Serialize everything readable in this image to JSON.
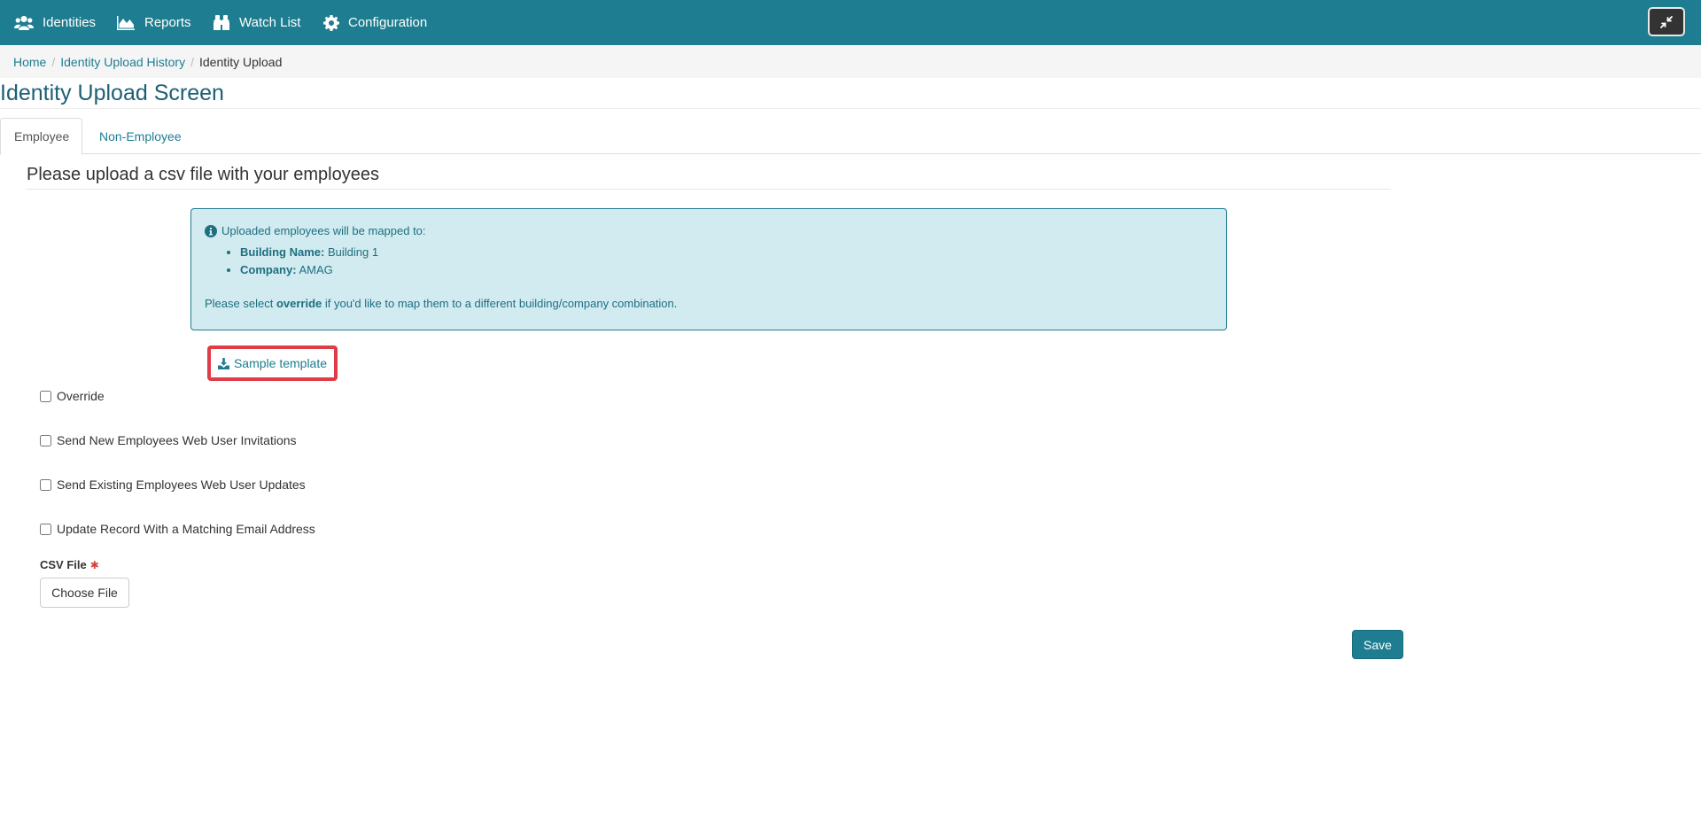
{
  "nav": {
    "items": [
      {
        "label": "Identities",
        "icon": "users-icon"
      },
      {
        "label": "Reports",
        "icon": "area-chart-icon"
      },
      {
        "label": "Watch List",
        "icon": "binoculars-icon"
      },
      {
        "label": "Configuration",
        "icon": "gear-icon"
      }
    ],
    "collapse_icon": "compress-icon"
  },
  "breadcrumb": {
    "home": "Home",
    "history": "Identity Upload History",
    "current": "Identity Upload",
    "separator": "/"
  },
  "page": {
    "title": "Identity Upload Screen"
  },
  "tabs": {
    "employee": "Employee",
    "non_employee": "Non-Employee"
  },
  "section": {
    "heading": "Please upload a csv file with your employees"
  },
  "alert": {
    "intro": "Uploaded employees will be mapped to:",
    "building_label": "Building Name:",
    "building_value": "Building 1",
    "company_label": "Company:",
    "company_value": "AMAG",
    "footer_before": "Please select ",
    "footer_bold": "override",
    "footer_after": " if you'd like to map them to a different building/company combination."
  },
  "sample_template": {
    "label": "Sample template",
    "icon": "download-icon"
  },
  "checkboxes": {
    "override": "Override",
    "send_new": "Send New Employees Web User Invitations",
    "send_existing": "Send Existing Employees Web User Updates",
    "update_email": "Update Record With a Matching Email Address"
  },
  "csv": {
    "label": "CSV File",
    "required_mark": "✱",
    "choose_label": "Choose File"
  },
  "save": {
    "label": "Save"
  },
  "colors": {
    "brand": "#1e7d90",
    "alert_bg": "#d1ebf0",
    "highlight": "#e03c47"
  }
}
